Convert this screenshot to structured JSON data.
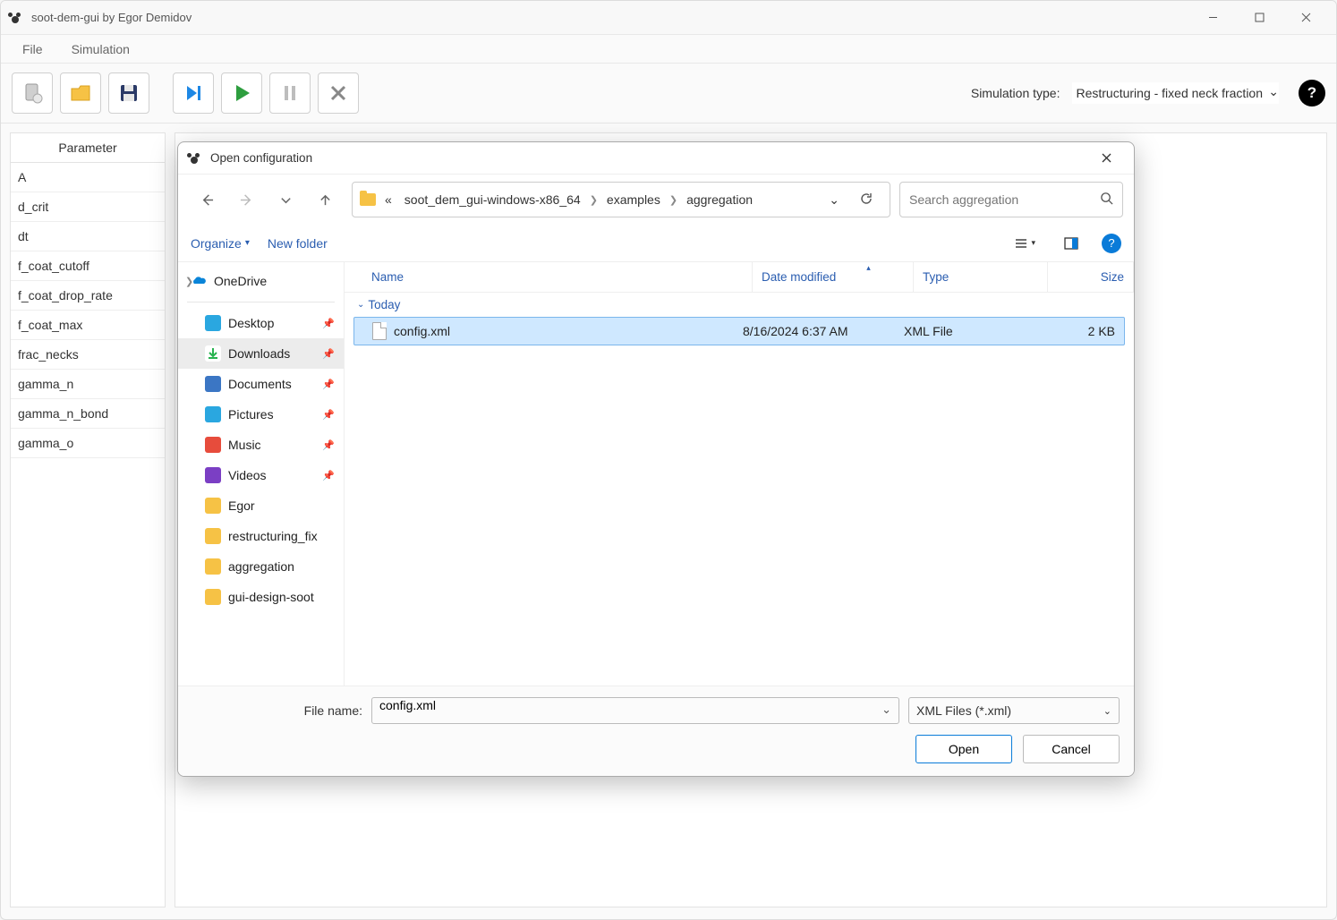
{
  "window": {
    "title": "soot-dem-gui by Egor Demidov"
  },
  "menu": {
    "file": "File",
    "simulation": "Simulation"
  },
  "toolbar": {
    "sim_type_label": "Simulation type:",
    "sim_type_value": "Restructuring - fixed neck fraction"
  },
  "param_panel": {
    "header": "Parameter",
    "rows": [
      "A",
      "d_crit",
      "dt",
      "f_coat_cutoff",
      "f_coat_drop_rate",
      "f_coat_max",
      "frac_necks",
      "gamma_n",
      "gamma_n_bond",
      "gamma_o"
    ]
  },
  "dialog": {
    "title": "Open configuration",
    "breadcrumb": {
      "ellipsis": "«",
      "seg1": "soot_dem_gui-windows-x86_64",
      "seg2": "examples",
      "seg3": "aggregation"
    },
    "search_placeholder": "Search aggregation",
    "cmd": {
      "organize": "Organize",
      "new_folder": "New folder"
    },
    "sidebar": {
      "onedrive": "OneDrive",
      "items": [
        {
          "label": "Desktop",
          "color": "#2aa7e0",
          "pin": true
        },
        {
          "label": "Downloads",
          "color": "#27b34f",
          "pin": true,
          "sel": true,
          "arrow": true
        },
        {
          "label": "Documents",
          "color": "#3b76c4",
          "pin": true
        },
        {
          "label": "Pictures",
          "color": "#2aa7e0",
          "pin": true
        },
        {
          "label": "Music",
          "color": "#e74c3c",
          "pin": true
        },
        {
          "label": "Videos",
          "color": "#7b3fc4",
          "pin": true
        },
        {
          "label": "Egor",
          "color": "#f6c245",
          "pin": false
        },
        {
          "label": "restructuring_fix",
          "color": "#f6c245",
          "pin": false
        },
        {
          "label": "aggregation",
          "color": "#f6c245",
          "pin": false
        },
        {
          "label": "gui-design-soot",
          "color": "#f6c245",
          "pin": false
        }
      ]
    },
    "file_header": {
      "name": "Name",
      "date": "Date modified",
      "type": "Type",
      "size": "Size"
    },
    "group": "Today",
    "files": [
      {
        "name": "config.xml",
        "date": "8/16/2024 6:37 AM",
        "type": "XML File",
        "size": "2 KB",
        "sel": true
      }
    ],
    "footer": {
      "fn_label": "File name:",
      "fn_value": "config.xml",
      "filter": "XML Files (*.xml)",
      "open": "Open",
      "cancel": "Cancel"
    }
  }
}
